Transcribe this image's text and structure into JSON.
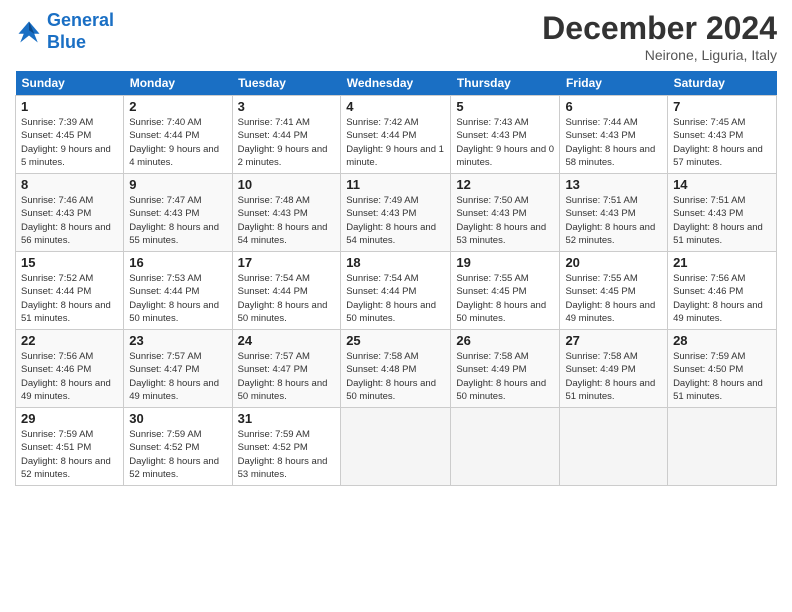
{
  "header": {
    "logo_line1": "General",
    "logo_line2": "Blue",
    "title": "December 2024",
    "location": "Neirone, Liguria, Italy"
  },
  "days_of_week": [
    "Sunday",
    "Monday",
    "Tuesday",
    "Wednesday",
    "Thursday",
    "Friday",
    "Saturday"
  ],
  "weeks": [
    [
      {
        "day": 1,
        "sunrise": "7:39 AM",
        "sunset": "4:45 PM",
        "daylight": "9 hours and 5 minutes."
      },
      {
        "day": 2,
        "sunrise": "7:40 AM",
        "sunset": "4:44 PM",
        "daylight": "9 hours and 4 minutes."
      },
      {
        "day": 3,
        "sunrise": "7:41 AM",
        "sunset": "4:44 PM",
        "daylight": "9 hours and 2 minutes."
      },
      {
        "day": 4,
        "sunrise": "7:42 AM",
        "sunset": "4:44 PM",
        "daylight": "9 hours and 1 minute."
      },
      {
        "day": 5,
        "sunrise": "7:43 AM",
        "sunset": "4:43 PM",
        "daylight": "9 hours and 0 minutes."
      },
      {
        "day": 6,
        "sunrise": "7:44 AM",
        "sunset": "4:43 PM",
        "daylight": "8 hours and 58 minutes."
      },
      {
        "day": 7,
        "sunrise": "7:45 AM",
        "sunset": "4:43 PM",
        "daylight": "8 hours and 57 minutes."
      }
    ],
    [
      {
        "day": 8,
        "sunrise": "7:46 AM",
        "sunset": "4:43 PM",
        "daylight": "8 hours and 56 minutes."
      },
      {
        "day": 9,
        "sunrise": "7:47 AM",
        "sunset": "4:43 PM",
        "daylight": "8 hours and 55 minutes."
      },
      {
        "day": 10,
        "sunrise": "7:48 AM",
        "sunset": "4:43 PM",
        "daylight": "8 hours and 54 minutes."
      },
      {
        "day": 11,
        "sunrise": "7:49 AM",
        "sunset": "4:43 PM",
        "daylight": "8 hours and 54 minutes."
      },
      {
        "day": 12,
        "sunrise": "7:50 AM",
        "sunset": "4:43 PM",
        "daylight": "8 hours and 53 minutes."
      },
      {
        "day": 13,
        "sunrise": "7:51 AM",
        "sunset": "4:43 PM",
        "daylight": "8 hours and 52 minutes."
      },
      {
        "day": 14,
        "sunrise": "7:51 AM",
        "sunset": "4:43 PM",
        "daylight": "8 hours and 51 minutes."
      }
    ],
    [
      {
        "day": 15,
        "sunrise": "7:52 AM",
        "sunset": "4:44 PM",
        "daylight": "8 hours and 51 minutes."
      },
      {
        "day": 16,
        "sunrise": "7:53 AM",
        "sunset": "4:44 PM",
        "daylight": "8 hours and 50 minutes."
      },
      {
        "day": 17,
        "sunrise": "7:54 AM",
        "sunset": "4:44 PM",
        "daylight": "8 hours and 50 minutes."
      },
      {
        "day": 18,
        "sunrise": "7:54 AM",
        "sunset": "4:44 PM",
        "daylight": "8 hours and 50 minutes."
      },
      {
        "day": 19,
        "sunrise": "7:55 AM",
        "sunset": "4:45 PM",
        "daylight": "8 hours and 50 minutes."
      },
      {
        "day": 20,
        "sunrise": "7:55 AM",
        "sunset": "4:45 PM",
        "daylight": "8 hours and 49 minutes."
      },
      {
        "day": 21,
        "sunrise": "7:56 AM",
        "sunset": "4:46 PM",
        "daylight": "8 hours and 49 minutes."
      }
    ],
    [
      {
        "day": 22,
        "sunrise": "7:56 AM",
        "sunset": "4:46 PM",
        "daylight": "8 hours and 49 minutes."
      },
      {
        "day": 23,
        "sunrise": "7:57 AM",
        "sunset": "4:47 PM",
        "daylight": "8 hours and 49 minutes."
      },
      {
        "day": 24,
        "sunrise": "7:57 AM",
        "sunset": "4:47 PM",
        "daylight": "8 hours and 50 minutes."
      },
      {
        "day": 25,
        "sunrise": "7:58 AM",
        "sunset": "4:48 PM",
        "daylight": "8 hours and 50 minutes."
      },
      {
        "day": 26,
        "sunrise": "7:58 AM",
        "sunset": "4:49 PM",
        "daylight": "8 hours and 50 minutes."
      },
      {
        "day": 27,
        "sunrise": "7:58 AM",
        "sunset": "4:49 PM",
        "daylight": "8 hours and 51 minutes."
      },
      {
        "day": 28,
        "sunrise": "7:59 AM",
        "sunset": "4:50 PM",
        "daylight": "8 hours and 51 minutes."
      }
    ],
    [
      {
        "day": 29,
        "sunrise": "7:59 AM",
        "sunset": "4:51 PM",
        "daylight": "8 hours and 52 minutes."
      },
      {
        "day": 30,
        "sunrise": "7:59 AM",
        "sunset": "4:52 PM",
        "daylight": "8 hours and 52 minutes."
      },
      {
        "day": 31,
        "sunrise": "7:59 AM",
        "sunset": "4:52 PM",
        "daylight": "8 hours and 53 minutes."
      },
      null,
      null,
      null,
      null
    ]
  ]
}
